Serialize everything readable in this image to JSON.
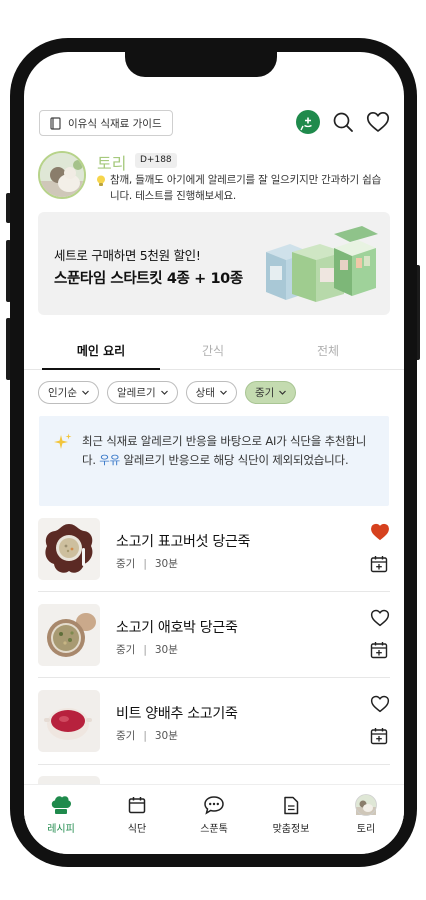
{
  "header": {
    "guide_label": "이유식 식재료 가이드",
    "icons": [
      "add-chat-icon",
      "search-icon",
      "favorites-heart-icon"
    ]
  },
  "profile": {
    "name": "토리",
    "dday": "D+188",
    "tip": "참깨, 들깨도 아기에게 알레르기를 잘 일으키지만 간과하기 쉽습니다. 테스트를 진행해보세요."
  },
  "banner": {
    "subtitle": "세트로 구매하면 5천원 할인!",
    "title": "스푼타임 스타트킷 4종 + 10종"
  },
  "tabs": [
    "메인 요리",
    "간식",
    "전체"
  ],
  "active_tab": "메인 요리",
  "filters": [
    "인기순",
    "알레르기",
    "상태",
    "중기"
  ],
  "active_filter": "중기",
  "ai_notice": {
    "part1": "최근 식재료 알레르기 반응을 바탕으로 AI가 식단을 추천합니다. ",
    "highlight": "우유",
    "part2": " 알레르기 반응으로 해당 식단이 제외되었습니다."
  },
  "recipes": [
    {
      "title": "소고기 표고버섯 당근죽",
      "stage": "중기",
      "time": "30분",
      "favorited": true
    },
    {
      "title": "소고기 애호박 당근죽",
      "stage": "중기",
      "time": "30분",
      "favorited": false
    },
    {
      "title": "비트 양배추 소고기죽",
      "stage": "중기",
      "time": "30분",
      "favorited": false
    }
  ],
  "nav": [
    "레시피",
    "식단",
    "스푼톡",
    "맞춤정보",
    "토리"
  ],
  "active_nav": "레시피",
  "colors": {
    "brand_green": "#1f8a4c",
    "name_green": "#a6c97d",
    "active_chip": "#c4dbb0",
    "heart_red": "#d6411e",
    "highlight_blue": "#3a79c8",
    "notice_bg": "#eef4fb"
  }
}
